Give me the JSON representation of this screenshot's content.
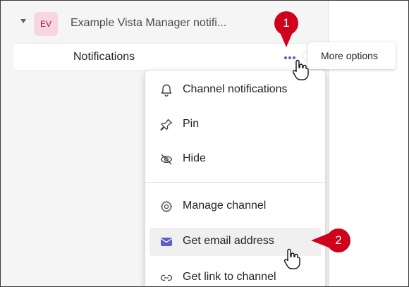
{
  "team": {
    "avatar_initials": "EV",
    "name": "Example Vista Manager notifi..."
  },
  "channel": {
    "name": "Notifications"
  },
  "tooltip": {
    "text": "More options"
  },
  "menu": {
    "items": [
      {
        "label": "Channel notifications",
        "icon": "bell-icon"
      },
      {
        "label": "Pin",
        "icon": "pin-icon"
      },
      {
        "label": "Hide",
        "icon": "eye-off-icon"
      },
      {
        "label": "Manage channel",
        "icon": "gear-icon"
      },
      {
        "label": "Get email address",
        "icon": "mail-icon"
      },
      {
        "label": "Get link to channel",
        "icon": "link-icon"
      }
    ]
  },
  "callouts": {
    "step1": "1",
    "step2": "2"
  },
  "colors": {
    "accent": "#5b5fc7",
    "callout": "#d0021b",
    "avatar_bg": "#f7d6e0"
  }
}
